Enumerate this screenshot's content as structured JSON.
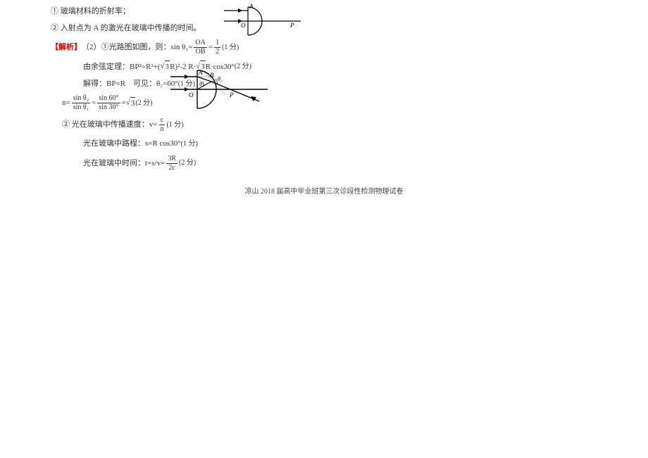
{
  "q1": "① 玻璃材料的折射率；",
  "q2": "② 入射点为 A 的激光在玻璃中传播的时间。",
  "analysis_label": "【解析】",
  "sol_intro": "（2）①光路图如图，则：sin θ₁=",
  "frac_oa_num": "OA",
  "frac_oa_den": "OB",
  "eq12_num": "1",
  "eq12_den": "2",
  "score1": "(1 分)",
  "cosine_pre": "由余弦定理：",
  "cosine_expr_a": "BP²=R²+(",
  "cosine_expr_b": "R)²-2 R·",
  "cosine_expr_c": "R·cos30°",
  "score2": "(2 分)",
  "solve": "解得：BP=R　可见：θ₂=60°",
  "score3": "(1 分)",
  "n_lhs": "n=",
  "n_f1_num": "sin θ₂",
  "n_f1_den": "sin θ₁",
  "n_eq": "=",
  "n_f2_num": "sin 60°",
  "n_f2_den": "sin 30°",
  "n_eq2": "=",
  "n_val": "3",
  "score4": " (2 分)",
  "step2_pre": "② 光在玻璃中传播速度：v=",
  "step2_num": "c",
  "step2_den": "n",
  "score5": "(1 分)",
  "step3": "光在玻璃中路程：s=R cos30°",
  "score6": "(1 分)",
  "step4_pre": "光在玻璃中时间：t=s/v=",
  "step4_num": "3R",
  "step4_den": "2c",
  "score7": "(2 分)",
  "footer": "凉山 2018 届高中毕业班第三次诊段性检测物理试卷",
  "diagram_labels": {
    "A": "A",
    "O": "O",
    "P": "P",
    "B": "B",
    "theta1": "θ₁",
    "theta2": "θ₂"
  }
}
